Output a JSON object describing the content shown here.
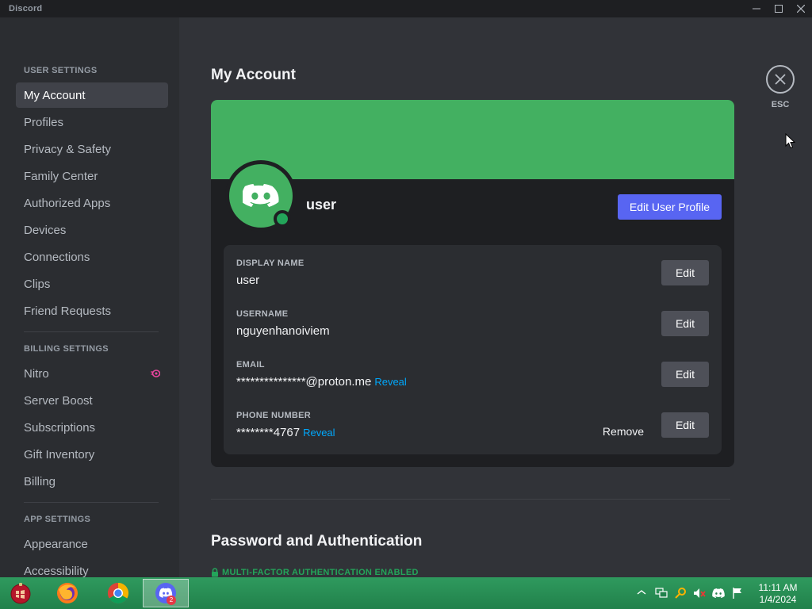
{
  "window": {
    "title": "Discord"
  },
  "sidebar": {
    "sections": [
      {
        "heading": "USER SETTINGS",
        "items": [
          "My Account",
          "Profiles",
          "Privacy & Safety",
          "Family Center",
          "Authorized Apps",
          "Devices",
          "Connections",
          "Clips",
          "Friend Requests"
        ]
      },
      {
        "heading": "BILLING SETTINGS",
        "items": [
          "Nitro",
          "Server Boost",
          "Subscriptions",
          "Gift Inventory",
          "Billing"
        ]
      },
      {
        "heading": "APP SETTINGS",
        "items": [
          "Appearance",
          "Accessibility"
        ]
      }
    ],
    "active_item": "My Account"
  },
  "main": {
    "title": "My Account",
    "profile": {
      "username": "user",
      "edit_profile_label": "Edit User Profile"
    },
    "fields": [
      {
        "label": "DISPLAY NAME",
        "value": "user",
        "edit_label": "Edit"
      },
      {
        "label": "USERNAME",
        "value": "nguyenhanoiviem",
        "edit_label": "Edit"
      },
      {
        "label": "EMAIL",
        "value": "***************@proton.me",
        "reveal_label": "Reveal",
        "edit_label": "Edit"
      },
      {
        "label": "PHONE NUMBER",
        "value": "********4767",
        "reveal_label": "Reveal",
        "remove_label": "Remove",
        "edit_label": "Edit"
      }
    ],
    "password_section_title": "Password and Authentication",
    "mfa_status": "MULTI-FACTOR AUTHENTICATION ENABLED",
    "close_label": "ESC"
  },
  "taskbar": {
    "apps": [
      "start-orb",
      "firefox",
      "chrome",
      "discord"
    ],
    "active_app": "discord",
    "discord_badge": "2",
    "clock": {
      "time": "11:11 AM",
      "date": "1/4/2024"
    }
  },
  "colors": {
    "banner": "#43b061",
    "accent": "#5865f2",
    "link": "#00a8fc",
    "online": "#23a55a",
    "mfa": "#23a55a",
    "nitro": "#eb459f"
  }
}
